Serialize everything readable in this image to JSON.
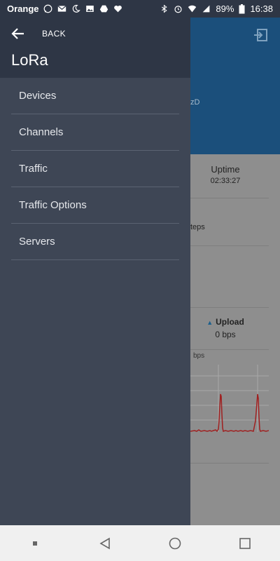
{
  "status_bar": {
    "carrier": "Orange",
    "battery": "89%",
    "time": "16:38",
    "left_icons": [
      "whatsapp-icon",
      "gmail-icon",
      "moon-icon",
      "image-icon",
      "drive-icon",
      "heart-icon"
    ],
    "right_icons": [
      "bluetooth-icon",
      "alarm-icon",
      "wifi-icon",
      "signal-icon",
      "battery-icon"
    ]
  },
  "drawer": {
    "back_label": "BACK",
    "title": "LoRa",
    "items": [
      {
        "label": "Devices"
      },
      {
        "label": "Channels"
      },
      {
        "label": "Traffic"
      },
      {
        "label": "Traffic Options"
      },
      {
        "label": "Servers"
      }
    ]
  },
  "background": {
    "partial_text": "zD",
    "uptime_label": "Uptime",
    "uptime_value": "02:33:27",
    "steps_text": "teps",
    "upload_label": "Upload",
    "upload_value": "0 bps",
    "chart_unit": "bps"
  },
  "colors": {
    "drawer_bg": "#3e4655",
    "drawer_header_bg": "#2e3645",
    "app_header_bg": "#1b4f7b",
    "chart_line": "#a02020"
  }
}
